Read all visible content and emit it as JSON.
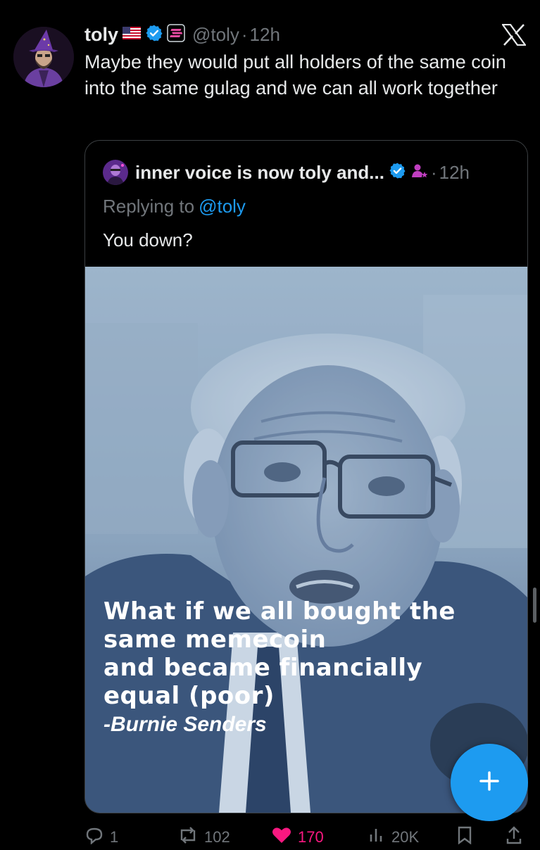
{
  "tweet": {
    "display_name": "toly",
    "handle": "@toly",
    "separator": "·",
    "time": "12h",
    "text": "Maybe they would put all holders of the same coin into the same gulag and we can all work together"
  },
  "quote": {
    "display_name": "inner voice is now toly and...",
    "separator": "·",
    "time": "12h",
    "replying_label": "Replying to",
    "replying_handle": "@toly",
    "text": "You down?",
    "image_text": {
      "lines": [
        "What if we all bought the",
        "same memecoin",
        "and became financially",
        "equal (poor)"
      ],
      "attribution": "-Burnie Senders"
    }
  },
  "actions": {
    "replies": "1",
    "reposts": "102",
    "likes": "170",
    "views": "20K"
  },
  "icons": {
    "flag": "us-flag-icon",
    "verified": "verified-badge-icon",
    "affiliation": "solana-badge-icon",
    "brand": "x-logo-icon",
    "compose": "plus-icon"
  },
  "colors": {
    "background": "#000000",
    "text": "#e7e9ea",
    "muted": "#71767b",
    "accent": "#1d9bf0",
    "like": "#f91880",
    "border": "#3c4043"
  }
}
